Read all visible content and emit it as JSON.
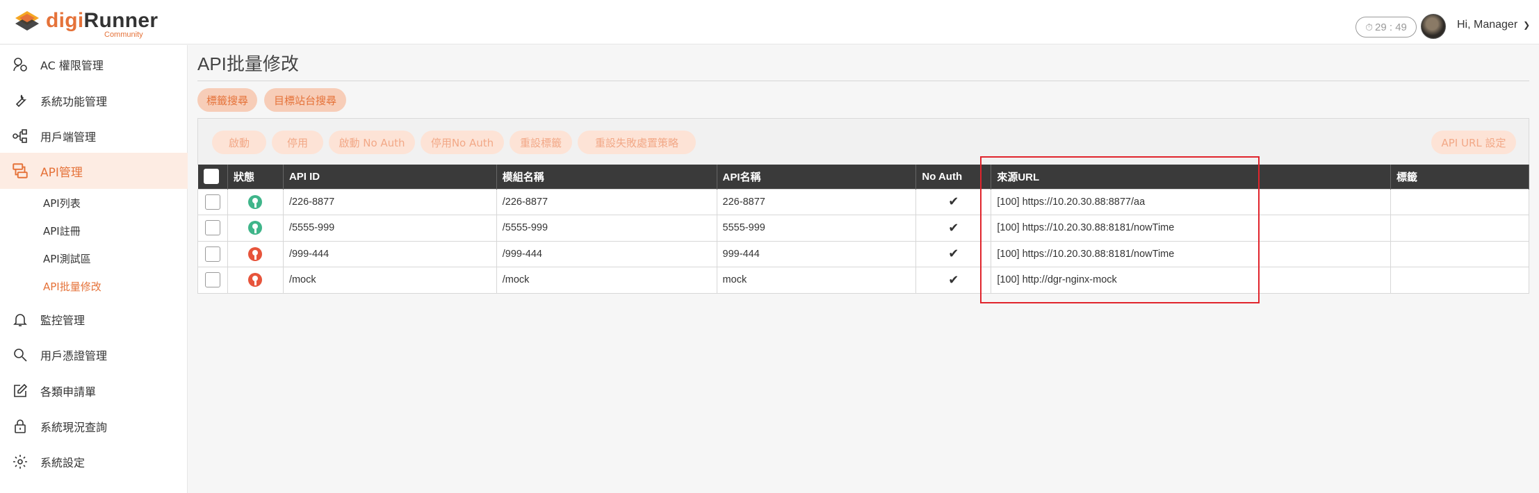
{
  "app": {
    "logo_digi": "digi",
    "logo_runner": "Runner",
    "logo_sub": "Community",
    "timer": "29 : 49",
    "greeting": "Hi, Manager"
  },
  "sidebar": {
    "items": [
      {
        "label": "AC 權限管理",
        "icon": "user-permission-icon"
      },
      {
        "label": "系統功能管理",
        "icon": "wrench-icon"
      },
      {
        "label": "用戶端管理",
        "icon": "client-nodes-icon"
      },
      {
        "label": "API管理",
        "icon": "api-icon"
      },
      {
        "label": "監控管理",
        "icon": "bell-icon"
      },
      {
        "label": "用戶憑證管理",
        "icon": "search-icon"
      },
      {
        "label": "各類申請單",
        "icon": "edit-icon"
      },
      {
        "label": "系統現況查詢",
        "icon": "lock-icon"
      },
      {
        "label": "系統設定",
        "icon": "gear-icon"
      }
    ],
    "sub_items": [
      "API列表",
      "API註冊",
      "API測試區",
      "API批量修改"
    ]
  },
  "main": {
    "title": "API批量修改",
    "search_tabs": [
      "標籤搜尋",
      "目標站台搜尋"
    ],
    "actions": [
      "啟動",
      "停用",
      "啟動 No Auth",
      "停用No Auth",
      "重設標籤",
      "重設失敗處置策略"
    ],
    "url_setting": "API URL 設定",
    "columns": [
      "狀態",
      "API ID",
      "模組名稱",
      "API名稱",
      "No Auth",
      "來源URL",
      "標籤"
    ],
    "rows": [
      {
        "status": "on",
        "api_id": "/226-8877",
        "module": "/226-8877",
        "name": "226-8877",
        "no_auth": "✔",
        "url": "[100] https://10.20.30.88:8877/aa",
        "tag": ""
      },
      {
        "status": "on",
        "api_id": "/5555-999",
        "module": "/5555-999",
        "name": "5555-999",
        "no_auth": "✔",
        "url": "[100] https://10.20.30.88:8181/nowTime",
        "tag": ""
      },
      {
        "status": "off",
        "api_id": "/999-444",
        "module": "/999-444",
        "name": "999-444",
        "no_auth": "✔",
        "url": "[100] https://10.20.30.88:8181/nowTime",
        "tag": ""
      },
      {
        "status": "off",
        "api_id": "/mock",
        "module": "/mock",
        "name": "mock",
        "no_auth": "✔",
        "url": "[100] http://dgr-nginx-mock",
        "tag": ""
      }
    ]
  },
  "colors": {
    "accent": "#e57239",
    "status_on": "#3fb58a",
    "status_off": "#e7543b",
    "highlight": "#e0242c"
  }
}
